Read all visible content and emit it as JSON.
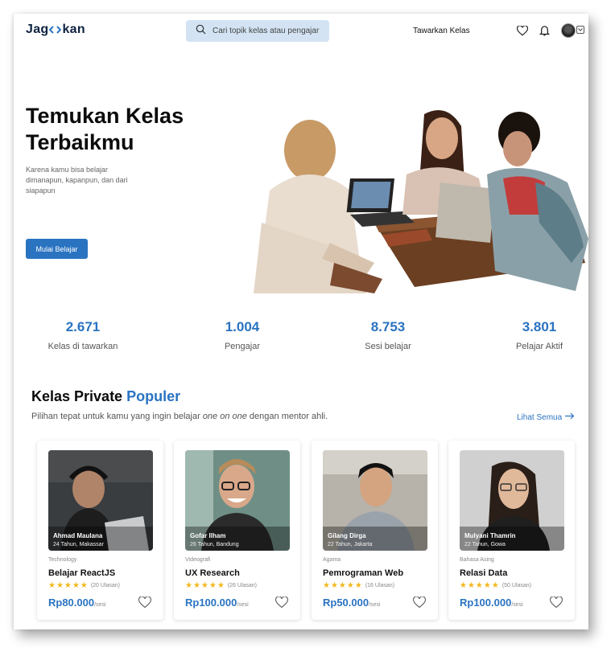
{
  "nav": {
    "logo_left": "Jag",
    "logo_right": "kan",
    "search_placeholder": "Cari topik kelas atau pengajar",
    "offer_link": "Tawarkan Kelas",
    "icons": [
      "heart-icon",
      "bell-icon",
      "avatar",
      "chevron-down-icon"
    ]
  },
  "hero": {
    "title": "Temukan Kelas Terbaikmu",
    "subtitle": "Karena kamu bisa belajar dimanapun, kapanpun, dan dari siapapun",
    "cta": "Mulai Belajar"
  },
  "stats": [
    {
      "value": "2.671",
      "label": "Kelas di tawarkan"
    },
    {
      "value": "1.004",
      "label": "Pengajar"
    },
    {
      "value": "8.753",
      "label": "Sesi belajar"
    },
    {
      "value": "3.801",
      "label": "Pelajar Aktif"
    }
  ],
  "section": {
    "title_main": "Kelas Private ",
    "title_accent": "Populer",
    "subtitle_pre": "Pilihan tepat untuk kamu yang ingin belajar ",
    "subtitle_em": "one on one",
    "subtitle_post": " dengan mentor ahli.",
    "see_all": "Lihat Semua"
  },
  "cards": [
    {
      "name": "Ahmad Maulana",
      "meta": "24 Tahun, Makassar",
      "category": "Technology",
      "title": "Belajar ReactJS",
      "stars": "★★★★★",
      "reviews": "(20 Ulasan)",
      "price": "Rp80.000",
      "unit": "/sesi"
    },
    {
      "name": "Gofar Ilham",
      "meta": "26 Tahun, Bandung",
      "category": "Videografi",
      "title": "UX Research",
      "stars": "★★★★★",
      "reviews": "(26 Ulasan)",
      "price": "Rp100.000",
      "unit": "/sesi"
    },
    {
      "name": "Gilang Dirga",
      "meta": "22 Tahun, Jakarta",
      "category": "Agama",
      "title": "Pemrograman Web",
      "stars": "★★★★★",
      "reviews": "(16 Ulasan)",
      "price": "Rp50.000",
      "unit": "/sesi"
    },
    {
      "name": "Mulyani Thamrin",
      "meta": "22 Tahun, Gowa",
      "category": "Bahasa Asing",
      "title": "Relasi Data",
      "stars": "★★★★★",
      "reviews": "(50 Ulasan)",
      "price": "Rp100.000",
      "unit": "/sesi"
    }
  ],
  "colors": {
    "accent": "#2a73c1",
    "search_bg": "#d3e3f3",
    "star": "#f3b81e"
  }
}
